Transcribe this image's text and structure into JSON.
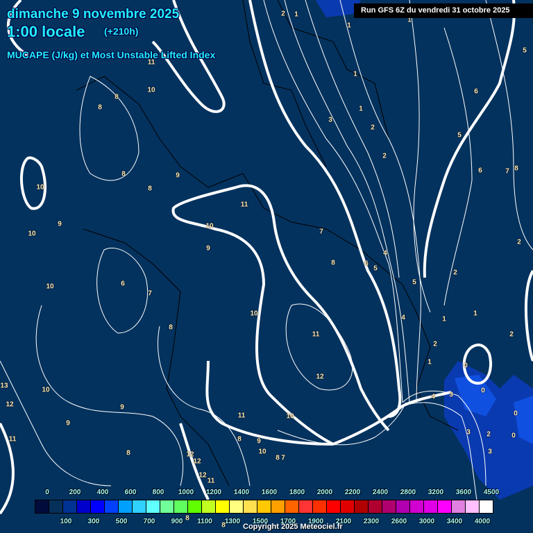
{
  "header": {
    "date": "dimanche 9 novembre 2025",
    "time": "1:00 locale",
    "lead": "(+210h)",
    "parameter": "MUCAPE (J/kg) et Most Unstable Lifted Index",
    "run": "Run GFS 6Z du vendredi 31 octobre 2025"
  },
  "colorbar": {
    "top_ticks": [
      "0",
      "200",
      "400",
      "600",
      "800",
      "1000",
      "1200",
      "1400",
      "1600",
      "1800",
      "2000",
      "2200",
      "2400",
      "2800",
      "3200",
      "3600",
      "4500"
    ],
    "bottom_ticks": [
      "100",
      "300",
      "500",
      "700",
      "900",
      "1100",
      "1300",
      "1500",
      "1700",
      "1900",
      "2100",
      "2300",
      "2600",
      "3000",
      "3400",
      "4000"
    ],
    "colors": [
      "#020c3c",
      "#05305a",
      "#003294",
      "#0000cc",
      "#0000ff",
      "#0040ff",
      "#00a0ff",
      "#30d0ff",
      "#60ffff",
      "#70ff98",
      "#60ff60",
      "#60ff00",
      "#c0ff20",
      "#ffff00",
      "#ffff80",
      "#ffe050",
      "#ffc800",
      "#ffa000",
      "#ff6400",
      "#ff3434",
      "#ff3000",
      "#ff0000",
      "#e00000",
      "#b00000",
      "#b00030",
      "#b00070",
      "#b000b0",
      "#d000d0",
      "#e000e8",
      "#ff00ff",
      "#e080e0",
      "#ffc0ff",
      "#ffffff"
    ]
  },
  "lifted_index_labels": [
    "2",
    "1",
    "1",
    "1",
    "5",
    "11",
    "10",
    "8",
    "8",
    "1",
    "1",
    "3",
    "2",
    "6",
    "5",
    "2",
    "6",
    "7",
    "8",
    "8",
    "9",
    "8",
    "10",
    "11",
    "9",
    "10",
    "10",
    "7",
    "2",
    "9",
    "8",
    "6",
    "5",
    "4",
    "2",
    "5",
    "6",
    "10",
    "7",
    "10",
    "4",
    "1",
    "1",
    "2",
    "8",
    "11",
    "2",
    "1",
    "0",
    "12",
    "0",
    "13",
    "10",
    "4",
    "3",
    "12",
    "9",
    "11",
    "10",
    "0",
    "9",
    "3",
    "2",
    "0",
    "11",
    "8",
    "9",
    "10",
    "8",
    "12",
    "12",
    "8",
    "7",
    "3",
    "12",
    "11",
    "8",
    "8"
  ],
  "copyright": "Copyright 2025 Meteociel.fr",
  "colors": {
    "background": "#04325e",
    "title": "#22f0ff"
  }
}
